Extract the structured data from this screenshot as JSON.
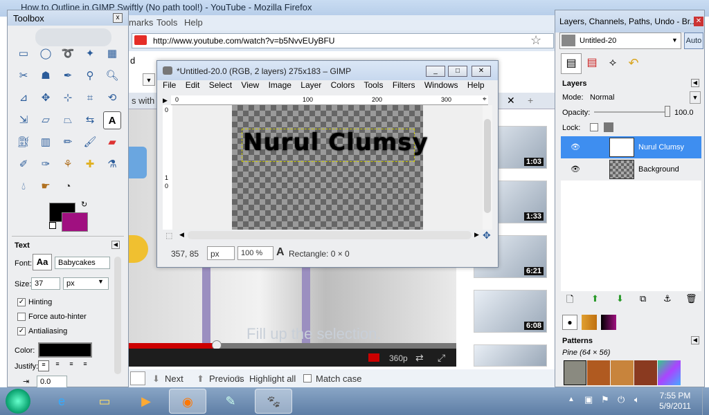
{
  "firefox": {
    "title": "How to Outline in GIMP Swiftly (No path tool!) - YouTube - Mozilla Firefox",
    "menu": [
      "marks",
      "Tools",
      "Help"
    ],
    "url": "http://www.youtube.com/watch?v=b5NvvEUyBFU",
    "tab_partial": "d",
    "tab_text": "s with",
    "video_caption": "Fill up the selection.",
    "video_quality": "360p",
    "thumb_durations": [
      "1:03",
      "1:33",
      "6:21",
      "6:08"
    ],
    "find_next": "Next",
    "find_previous": "Previous",
    "find_highlight": "Highlight all",
    "find_match_case": "Match case"
  },
  "toolbox": {
    "title": "Toolbox",
    "close": "x",
    "section_text": "Text",
    "font_label": "Font:",
    "font_preview": "Aa",
    "font_value": "Babycakes",
    "size_label": "Size:",
    "size_value": "37",
    "size_unit": "px",
    "hinting": "Hinting",
    "force_autohinter": "Force auto-hinter",
    "antialiasing": "Antialiasing",
    "color_label": "Color:",
    "justify_label": "Justify:",
    "indent_value": "0.0",
    "colors": {
      "fg": "#000000",
      "bg": "#a01080"
    }
  },
  "gimp_window": {
    "title": "*Untitled-20.0 (RGB, 2 layers) 275x183 – GIMP",
    "menu": [
      "File",
      "Edit",
      "Select",
      "View",
      "Image",
      "Layer",
      "Colors",
      "Tools",
      "Filters",
      "Windows",
      "Help"
    ],
    "ruler_h": [
      "0",
      "100",
      "200",
      "300"
    ],
    "ruler_v": [
      "0",
      "1",
      "0"
    ],
    "image_text": "Nurul Clumsy",
    "coords": "357, 85",
    "unit": "px",
    "zoom": "100 %",
    "status": "Rectangle: 0 × 0"
  },
  "dock": {
    "title": "Layers, Channels, Paths, Undo - Br...",
    "image_select": "Untitled-20",
    "auto": "Auto",
    "section": "Layers",
    "mode_label": "Mode:",
    "mode_value": "Normal",
    "opacity_label": "Opacity:",
    "opacity_value": "100.0",
    "lock_label": "Lock:",
    "layers": [
      "Nurul Clumsy",
      "Background"
    ],
    "patterns_title": "Patterns",
    "pattern_name": "Pine (64 × 56)"
  },
  "taskbar": {
    "time": "7:55 PM",
    "date": "5/9/2011"
  }
}
